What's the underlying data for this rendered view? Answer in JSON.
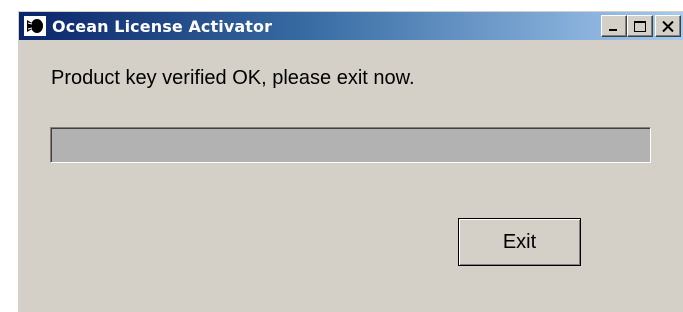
{
  "window": {
    "title": "Ocean License Activator",
    "icon": "ocean-app-icon",
    "controls": {
      "minimize_icon": "minimize-icon",
      "maximize_icon": "maximize-icon",
      "close_icon": "close-icon"
    }
  },
  "main": {
    "message": "Product key verified OK, please exit now.",
    "progress": 0,
    "exit_label": "Exit"
  },
  "colors": {
    "title_gradient_start": "#0a246a",
    "title_gradient_end": "#a6caf0",
    "window_bg": "#d4d0c8",
    "progress_bg": "#b2b2b2"
  }
}
